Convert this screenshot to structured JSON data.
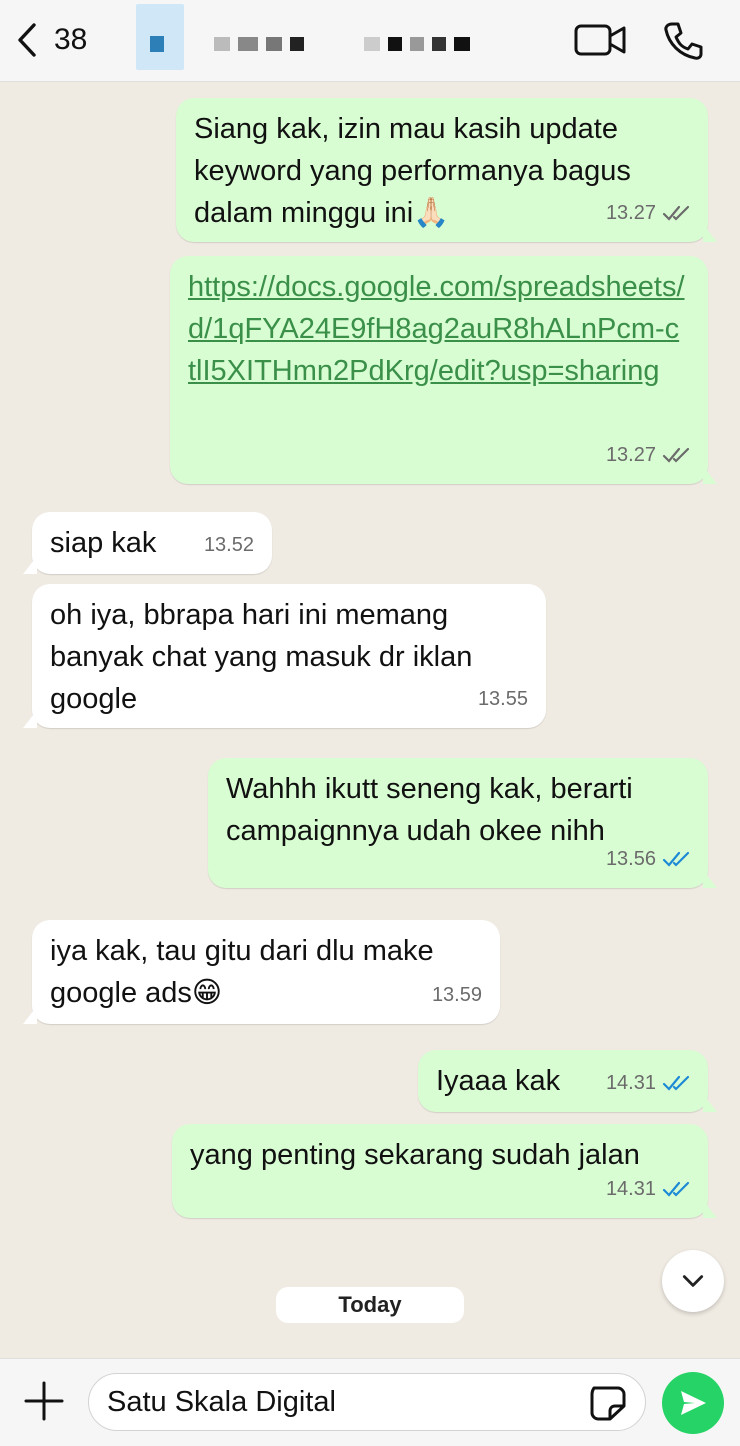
{
  "header": {
    "back_count": "38",
    "video_icon": "video-camera-icon",
    "phone_icon": "phone-icon"
  },
  "messages": [
    {
      "dir": "out",
      "text": "Siang kak, izin mau kasih update keyword yang performanya bagus dalam minggu ini🙏🏻",
      "time": "13.27",
      "status": "read-grey"
    },
    {
      "dir": "out",
      "text": "https://docs.google.com/spreadsheets/d/1qFYA24E9fH8ag2auR8hALnPcm-ctlI5XITHmn2PdKrg/edit?usp=sharing",
      "time": "13.27",
      "status": "read-grey"
    },
    {
      "dir": "in",
      "text": "siap kak",
      "time": "13.52"
    },
    {
      "dir": "in",
      "text": "oh iya, bbrapa hari ini memang banyak chat yang masuk dr iklan google",
      "time": "13.55"
    },
    {
      "dir": "out",
      "text": "Wahhh ikutt seneng kak, berarti campaignnya udah okee nihh",
      "time": "13.56",
      "status": "read-blue"
    },
    {
      "dir": "in",
      "text": "iya kak, tau gitu dari dlu make google ads😁",
      "time": "13.59"
    },
    {
      "dir": "out",
      "text": "Iyaaa kak",
      "time": "14.31",
      "status": "read-blue"
    },
    {
      "dir": "out",
      "text": "yang penting sekarang sudah jalan",
      "time": "14.31",
      "status": "read-blue"
    }
  ],
  "date_divider": "Today",
  "composer": {
    "value": "Satu Skala Digital"
  },
  "colors": {
    "outgoing_bubble": "#d9fdd3",
    "incoming_bubble": "#ffffff",
    "read_tick_blue": "#1e8ad6",
    "read_tick_grey": "#6b6b6b",
    "send_button": "#25d366",
    "link": "#3a8f49"
  }
}
